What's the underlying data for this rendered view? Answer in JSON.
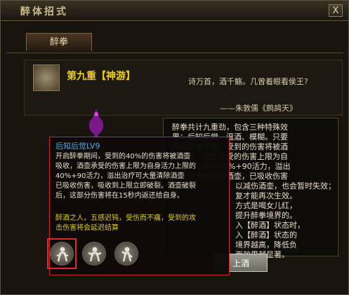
{
  "window": {
    "title": "醉体招式",
    "close_label": "X"
  },
  "tabs": [
    {
      "label": "醉拳"
    }
  ],
  "skill": {
    "name": "第九重【神游】",
    "icon": "drunk-fist-icon"
  },
  "poem": {
    "line": "诗万首，酒千觞。几曾着眼看侯王?",
    "source": "——朱敦儒《鹧鸪天》"
  },
  "description": [
    "醉拳共计九重劲，包含三种特殊效",
    "果：后知后觉、温酒、模糊。只要",
    "开启醉拳功能，受到的伤害将被酒",
    "壶吸收，酒壶承受的伤害上限为自",
    "身活力上限的40%+90活力，溢出",
    "治疗可大量清除酒壶，已吸收伤害",
    "以减伤酒壶，也会暂时失效；",
    "复才能再次生效。",
    "方式是喝女儿红，",
    "提升醉拳境界的。",
    "入【醉酒】状态时，",
    "入【醉酒】状态的",
    "境界越高，降低负",
    "面效果越显著。"
  ],
  "pour_button": "上酒",
  "tooltip": {
    "title": "后知后觉LV9",
    "body": [
      "开启醉拳期间，受到的40%的伤害将被酒壶",
      "吸收，酒壶承受的伤害上限为自身活力上限的",
      "40%+90活力，溢出治疗可大量清除酒壶",
      "已吸收伤害，吸收到上限立即破裂。酒壶破裂",
      "后，这部分伤害将在15秒内返还给自身。"
    ],
    "effect": [
      "醉酒之人，五感迟钝，受伤而不痛，受到的攻",
      "击伤害将会延迟结算"
    ]
  },
  "skill_buttons": [
    {
      "icon": "drunk-stance-icon-1"
    },
    {
      "icon": "drunk-stance-icon-2"
    },
    {
      "icon": "drunk-stance-icon-3"
    }
  ]
}
